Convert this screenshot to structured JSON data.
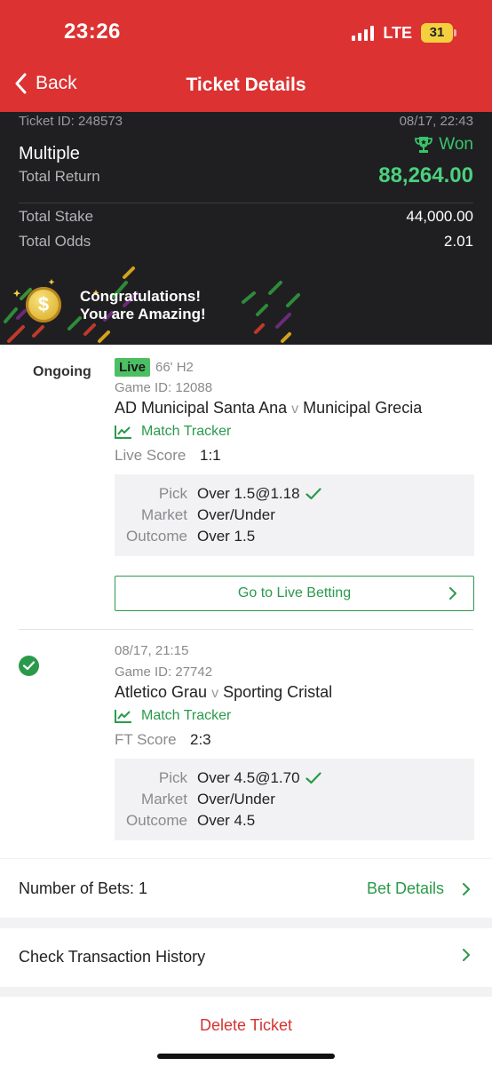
{
  "status_bar": {
    "time": "23:26",
    "network": "LTE",
    "battery": "31"
  },
  "nav": {
    "back_label": "Back",
    "title": "Ticket Details"
  },
  "ticket": {
    "id": "Ticket ID: 248573",
    "date": "08/17, 22:43",
    "type": "Multiple",
    "status": "Won",
    "total_return_label": "Total Return",
    "total_return": "88,264.00",
    "total_stake_label": "Total Stake",
    "total_stake": "44,000.00",
    "total_odds_label": "Total Odds",
    "total_odds": "2.01",
    "congrats_line1": "Congratulations!",
    "congrats_line2": "You are Amazing!",
    "coin_symbol": "$"
  },
  "bets": [
    {
      "state": "Ongoing",
      "live_badge": "Live",
      "live_time": "66' H2",
      "game_id": "Game ID: 12088",
      "home": "AD Municipal Santa Ana",
      "vs": "v",
      "away": "Municipal Grecia",
      "tracker": "Match Tracker",
      "score_label": "Live Score",
      "score": "1:1",
      "pick_label": "Pick",
      "pick": "Over 1.5@1.18",
      "market_label": "Market",
      "market": "Over/Under",
      "outcome_label": "Outcome",
      "outcome": "Over 1.5",
      "live_button": "Go to Live Betting"
    },
    {
      "date": "08/17, 21:15",
      "game_id": "Game ID: 27742",
      "home": "Atletico Grau",
      "vs": "v",
      "away": "Sporting Cristal",
      "tracker": "Match Tracker",
      "score_label": "FT Score",
      "score": "2:3",
      "pick_label": "Pick",
      "pick": "Over 4.5@1.70",
      "market_label": "Market",
      "market": "Over/Under",
      "outcome_label": "Outcome",
      "outcome": "Over 4.5"
    }
  ],
  "footer": {
    "number_of_bets": "Number of Bets: 1",
    "bet_details": "Bet Details",
    "transaction_history": "Check Transaction History",
    "delete": "Delete Ticket"
  },
  "colors": {
    "brand_red": "#dc3232",
    "win_green": "#4cd07d",
    "accent_green": "#2a9a4a",
    "live_green": "#4cbf62",
    "dark_panel": "#1f1f22"
  },
  "icons": [
    "chevron-left-icon",
    "trophy-icon",
    "coin-icon",
    "chart-icon",
    "checkmark-icon",
    "chevron-right-icon",
    "check-circle-icon"
  ]
}
